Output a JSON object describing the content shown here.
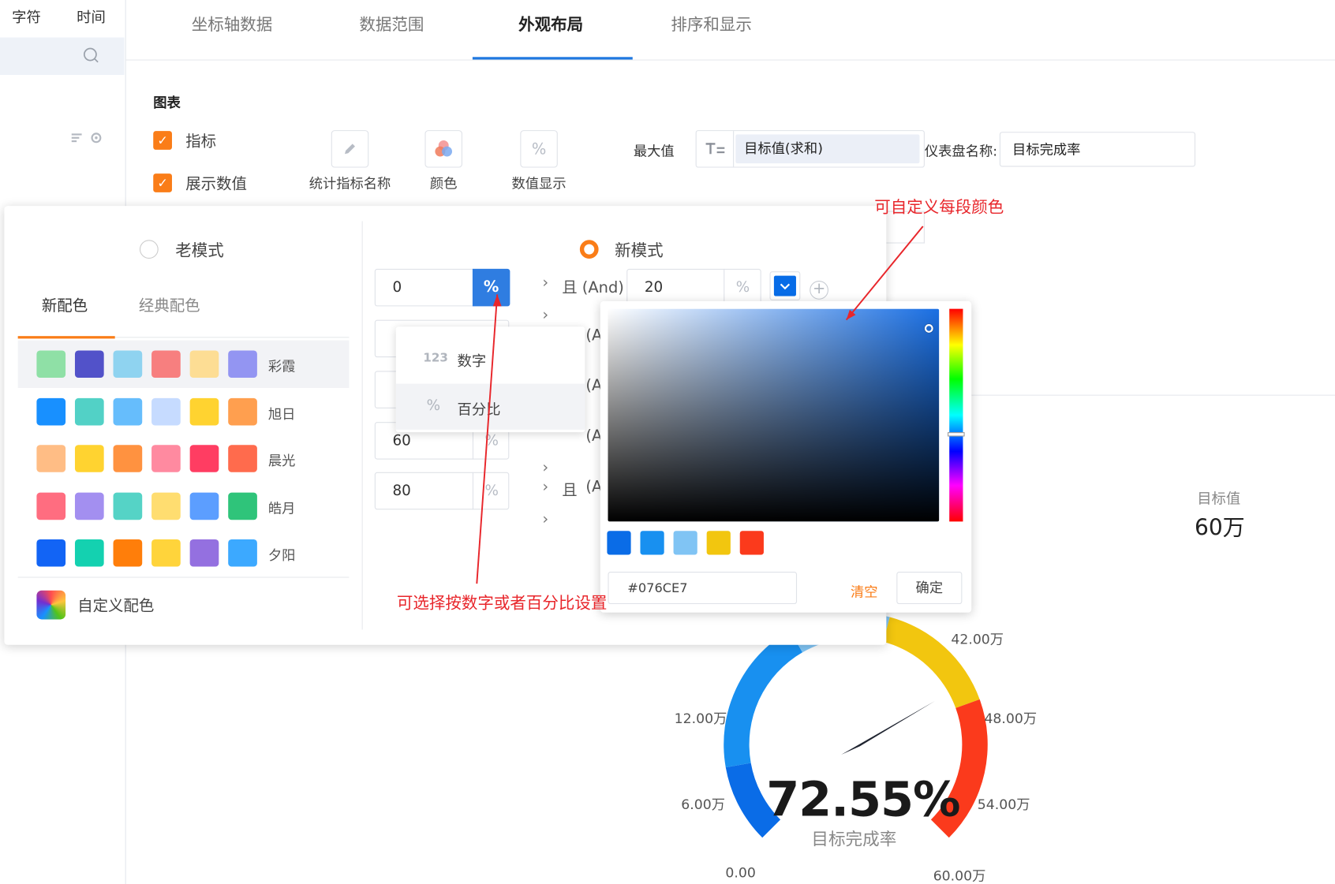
{
  "left_panel": {
    "tab_char": "字符",
    "tab_time": "时间"
  },
  "tabs": [
    {
      "label": "坐标轴数据"
    },
    {
      "label": "数据范围"
    },
    {
      "label": "外观布局"
    },
    {
      "label": "排序和显示"
    }
  ],
  "chart_section": {
    "title": "图表",
    "check_metric": "指标",
    "check_show_value": "展示数值",
    "tool_stat_name": "统计指标名称",
    "tool_color": "颜色",
    "tool_value_display": "数值显示",
    "percent_glyph": "%",
    "max_label": "最大值",
    "max_value": "目标值(求和)",
    "gauge_name_label": "仪表盘名称:",
    "gauge_name_value": "目标完成率"
  },
  "color_popover": {
    "old_mode": "老模式",
    "new_mode": "新模式",
    "tab_new": "新配色",
    "tab_classic": "经典配色",
    "palettes": [
      {
        "name": "彩霞",
        "colors": [
          "#8fe0a6",
          "#5252c9",
          "#8fd3f0",
          "#f77f7f",
          "#fddd94",
          "#9395f2"
        ]
      },
      {
        "name": "旭日",
        "colors": [
          "#1890ff",
          "#52d1c6",
          "#66bdfc",
          "#c6dbff",
          "#ffd330",
          "#ff9f4f"
        ]
      },
      {
        "name": "晨光",
        "colors": [
          "#ffbd85",
          "#ffd330",
          "#ff9240",
          "#ff8aa0",
          "#ff3d62",
          "#ff6b4d"
        ]
      },
      {
        "name": "皓月",
        "colors": [
          "#ff6d80",
          "#a38ff0",
          "#55d3c6",
          "#ffdd70",
          "#5c9eff",
          "#2fc47a"
        ]
      },
      {
        "name": "夕阳",
        "colors": [
          "#1264f5",
          "#14d1b0",
          "#ff7e0a",
          "#ffd43b",
          "#9470e0",
          "#3ca9ff"
        ]
      }
    ],
    "custom_color": "自定义配色",
    "ranges": [
      {
        "value": "0",
        "unit": "%"
      },
      {
        "value": "20",
        "unit": "%"
      },
      {
        "value": "80",
        "unit": "%"
      }
    ],
    "partial_value": "60",
    "and_label": "且 (And)",
    "and_partial": "(A",
    "qie": "且",
    "chev": "›",
    "plus": "+",
    "unit_menu": [
      {
        "icon": "123",
        "label": "数字"
      },
      {
        "icon": "%",
        "label": "百分比"
      }
    ]
  },
  "color_picker": {
    "presets": [
      "#0a6ce7",
      "#1890f0",
      "#80c4f4",
      "#f2c60f",
      "#fb3a1c"
    ],
    "hex": "#076CE7",
    "clear": "清空",
    "confirm": "确定"
  },
  "annotations": {
    "custom_segment": "可自定义每段颜色",
    "number_or_percent": "可选择按数字或者百分比设置"
  },
  "gauge": {
    "target_label": "目标值",
    "target_value": "60万",
    "percent": "72.55%",
    "name": "目标完成率",
    "tick_labels": [
      "0.00",
      "6.00万",
      "12.00万",
      "42.00万",
      "48.00万",
      "54.00万",
      "60.00万"
    ]
  }
}
